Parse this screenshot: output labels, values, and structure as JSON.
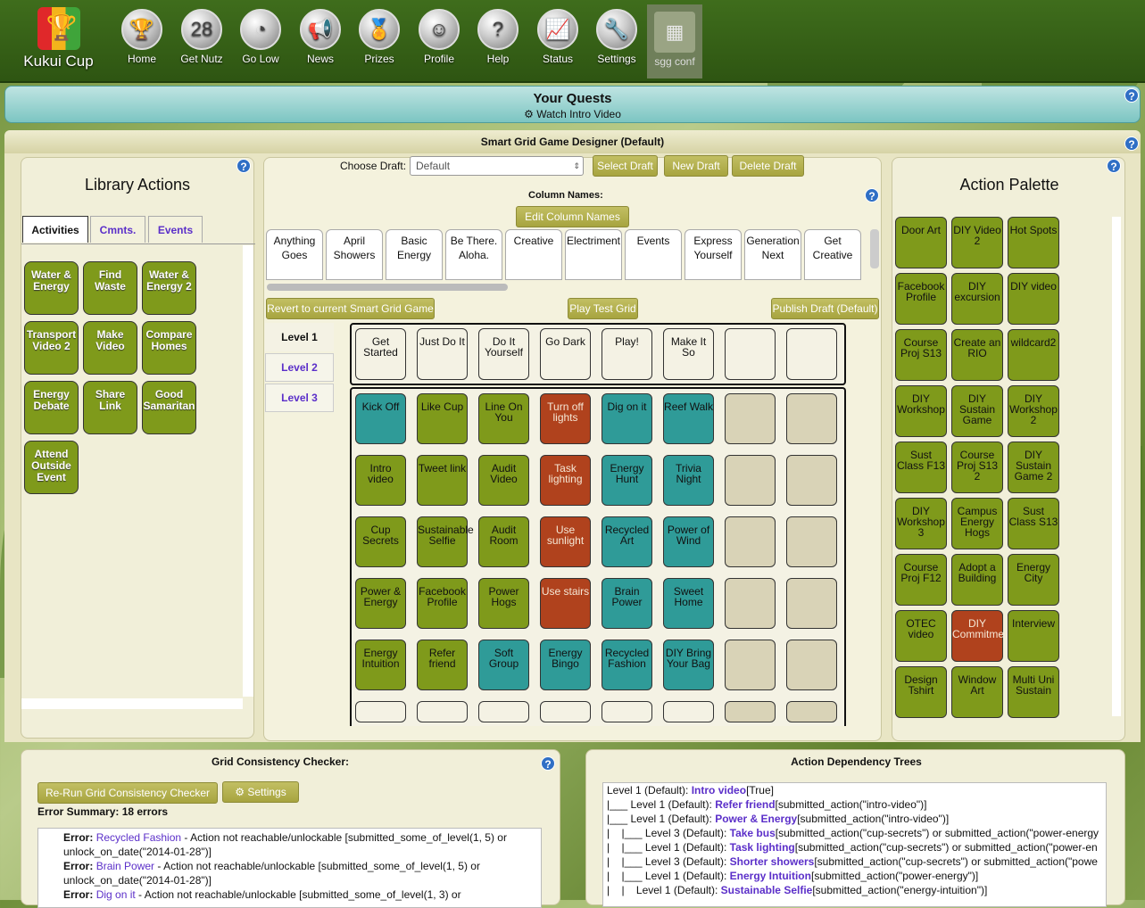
{
  "app": {
    "name": "Kukui Cup"
  },
  "nav": [
    {
      "label": "Home",
      "icon": "trophy-icon",
      "glyph": "🏆"
    },
    {
      "label": "Get Nutz",
      "icon": "counter-icon",
      "glyph": "28"
    },
    {
      "label": "Go Low",
      "icon": "gauge-icon",
      "glyph": "◔"
    },
    {
      "label": "News",
      "icon": "megaphone-icon",
      "glyph": "📢"
    },
    {
      "label": "Prizes",
      "icon": "ribbon-icon",
      "glyph": "🏅"
    },
    {
      "label": "Profile",
      "icon": "profile-card-icon",
      "glyph": "☺"
    },
    {
      "label": "Help",
      "icon": "question-icon",
      "glyph": "?"
    },
    {
      "label": "Status",
      "icon": "chart-icon",
      "glyph": "📈"
    },
    {
      "label": "Settings",
      "icon": "wrench-icon",
      "glyph": "🔧"
    }
  ],
  "nav_active": {
    "label": "sgg conf",
    "icon": "grid-icon",
    "glyph": "▦"
  },
  "quests": {
    "title": "Your Quests",
    "item": "Watch Intro Video"
  },
  "designer": {
    "title": "Smart Grid Game Designer (Default)"
  },
  "library": {
    "title": "Library Actions",
    "tabs": [
      "Activities",
      "Cmnts.",
      "Events"
    ],
    "items": [
      "Water & Energy",
      "Find Waste",
      "Water & Energy 2",
      "Transport Video 2",
      "Make Video",
      "Compare Homes",
      "Energy Debate",
      "Share Link",
      "Good Samaritan",
      "Attend Outside Event"
    ]
  },
  "draft": {
    "label": "Choose Draft:",
    "value": "Default",
    "select": "Select Draft",
    "new": "New Draft",
    "delete": "Delete Draft"
  },
  "columns": {
    "label": "Column Names:",
    "edit": "Edit Column Names",
    "names": [
      "Anything Goes",
      "April Showers",
      "Basic Energy",
      "Be There. Aloha.",
      "Creative",
      "Electriment",
      "Events",
      "Express Yourself",
      "Generation Next",
      "Get Creative"
    ]
  },
  "grid_buttons": {
    "revert": "Revert to current Smart Grid Game",
    "play": "Play Test Grid",
    "publish": "Publish Draft (Default)"
  },
  "levels": [
    "Level 1",
    "Level 2",
    "Level 3"
  ],
  "grid_headers": [
    "Get Started",
    "Just Do It",
    "Do It Yourself",
    "Go Dark",
    "Play!",
    "Make It So"
  ],
  "grid": [
    [
      {
        "t": "Kick Off",
        "c": "b"
      },
      {
        "t": "Like Cup",
        "c": "g"
      },
      {
        "t": "Line On You",
        "c": "g"
      },
      {
        "t": "Turn off lights",
        "c": "r"
      },
      {
        "t": "Dig on it",
        "c": "b"
      },
      {
        "t": "Reef Walk",
        "c": "b"
      }
    ],
    [
      {
        "t": "Intro video",
        "c": "g"
      },
      {
        "t": "Tweet link",
        "c": "g"
      },
      {
        "t": "Audit Video",
        "c": "g"
      },
      {
        "t": "Task lighting",
        "c": "r"
      },
      {
        "t": "Energy Hunt",
        "c": "b"
      },
      {
        "t": "Trivia Night",
        "c": "b"
      }
    ],
    [
      {
        "t": "Cup Secrets",
        "c": "g"
      },
      {
        "t": "Sustainable Selfie",
        "c": "g"
      },
      {
        "t": "Audit Room",
        "c": "g"
      },
      {
        "t": "Use sunlight",
        "c": "r"
      },
      {
        "t": "Recycled Art",
        "c": "b"
      },
      {
        "t": "Power of Wind",
        "c": "b"
      }
    ],
    [
      {
        "t": "Power & Energy",
        "c": "g"
      },
      {
        "t": "Facebook Profile",
        "c": "g"
      },
      {
        "t": "Power Hogs",
        "c": "g"
      },
      {
        "t": "Use stairs",
        "c": "r"
      },
      {
        "t": "Brain Power",
        "c": "b"
      },
      {
        "t": "Sweet Home",
        "c": "b"
      }
    ],
    [
      {
        "t": "Energy Intuition",
        "c": "g"
      },
      {
        "t": "Refer friend",
        "c": "g"
      },
      {
        "t": "Soft Group",
        "c": "b"
      },
      {
        "t": "Energy Bingo",
        "c": "b"
      },
      {
        "t": "Recycled Fashion",
        "c": "b"
      },
      {
        "t": "DIY Bring Your Bag",
        "c": "b"
      }
    ]
  ],
  "palette": {
    "title": "Action Palette",
    "items": [
      {
        "t": "Door Art",
        "c": "g"
      },
      {
        "t": "DIY Video 2",
        "c": "g"
      },
      {
        "t": "Hot Spots",
        "c": "g"
      },
      {
        "t": "Facebook Profile",
        "c": "g"
      },
      {
        "t": "DIY excursion",
        "c": "g"
      },
      {
        "t": "DIY video",
        "c": "g"
      },
      {
        "t": "Course Proj S13",
        "c": "g"
      },
      {
        "t": "Create an RIO",
        "c": "g"
      },
      {
        "t": "wildcard2",
        "c": "g"
      },
      {
        "t": "DIY Workshop",
        "c": "g"
      },
      {
        "t": "DIY Sustain Game",
        "c": "g"
      },
      {
        "t": "DIY Workshop 2",
        "c": "g"
      },
      {
        "t": "Sust Class F13",
        "c": "g"
      },
      {
        "t": "Course Proj S13 2",
        "c": "g"
      },
      {
        "t": "DIY Sustain Game 2",
        "c": "g"
      },
      {
        "t": "DIY Workshop 3",
        "c": "g"
      },
      {
        "t": "Campus Energy Hogs",
        "c": "g"
      },
      {
        "t": "Sust Class S13",
        "c": "g"
      },
      {
        "t": "Course Proj F12",
        "c": "g"
      },
      {
        "t": "Adopt a Building",
        "c": "g"
      },
      {
        "t": "Energy City",
        "c": "g"
      },
      {
        "t": "OTEC video",
        "c": "g"
      },
      {
        "t": "DIY Commitment",
        "c": "r"
      },
      {
        "t": "Interview",
        "c": "g"
      },
      {
        "t": "Design Tshirt",
        "c": "g"
      },
      {
        "t": "Window Art",
        "c": "g"
      },
      {
        "t": "Multi Uni Sustain",
        "c": "g"
      }
    ]
  },
  "checker": {
    "title": "Grid Consistency Checker:",
    "rerun": "Re-Run Grid Consistency Checker",
    "settings": "Settings",
    "summary": "Error Summary: 18 errors",
    "errors": [
      {
        "k": "Error: ",
        "a": "Recycled Fashion",
        "m": " - Action not reachable/unlockable [submitted_some_of_level(1, 5) or"
      },
      {
        "k": "",
        "a": "",
        "m": "unlock_on_date(\"2014-01-28\")]"
      },
      {
        "k": "Error: ",
        "a": "Brain Power",
        "m": " - Action not reachable/unlockable [submitted_some_of_level(1, 5) or"
      },
      {
        "k": "",
        "a": "",
        "m": "unlock_on_date(\"2014-01-28\")]"
      },
      {
        "k": "Error: ",
        "a": "Dig on it",
        "m": " - Action not reachable/unlockable [submitted_some_of_level(1, 3) or"
      }
    ]
  },
  "trees": {
    "title": "Action Dependency Trees",
    "lines": [
      {
        "p": "Level 1 (Default): ",
        "a": "Intro video",
        "s": "[True]"
      },
      {
        "p": "|___ Level 1 (Default): ",
        "a": "Refer friend",
        "s": "[submitted_action(\"intro-video\")]"
      },
      {
        "p": "|___ Level 1 (Default): ",
        "a": "Power & Energy",
        "s": "[submitted_action(\"intro-video\")]"
      },
      {
        "p": "|    |___ Level 3 (Default): ",
        "a": "Take bus",
        "s": "[submitted_action(\"cup-secrets\") or submitted_action(\"power-energy"
      },
      {
        "p": "|    |___ Level 1 (Default): ",
        "a": "Task lighting",
        "s": "[submitted_action(\"cup-secrets\") or submitted_action(\"power-en"
      },
      {
        "p": "|    |___ Level 3 (Default): ",
        "a": "Shorter showers",
        "s": "[submitted_action(\"cup-secrets\") or submitted_action(\"powe"
      },
      {
        "p": "|    |___ Level 1 (Default): ",
        "a": "Energy Intuition",
        "s": "[submitted_action(\"power-energy\")]"
      },
      {
        "p": "|    |    Level 1 (Default): ",
        "a": "Sustainable Selfie",
        "s": "[submitted_action(\"energy-intuition\")]"
      }
    ]
  },
  "help_glyph": "?"
}
